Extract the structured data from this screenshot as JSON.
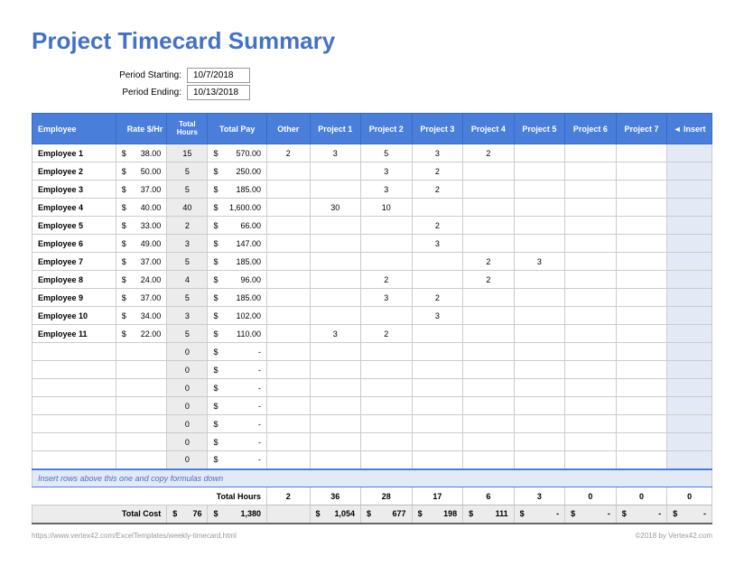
{
  "title": "Project Timecard Summary",
  "period": {
    "start_label": "Period Starting:",
    "start_value": "10/7/2018",
    "end_label": "Period Ending:",
    "end_value": "10/13/2018"
  },
  "columns": {
    "employee": "Employee",
    "rate": "Rate $/Hr",
    "total_hours_l1": "Total",
    "total_hours_l2": "Hours",
    "total_pay": "Total Pay",
    "other": "Other",
    "p1": "Project 1",
    "p2": "Project 2",
    "p3": "Project 3",
    "p4": "Project 4",
    "p5": "Project 5",
    "p6": "Project 6",
    "p7": "Project 7",
    "insert": "◄ Insert"
  },
  "rows": [
    {
      "emp": "Employee 1",
      "rate": "38.00",
      "hours": "15",
      "pay": "570.00",
      "other": "2",
      "p": [
        "3",
        "5",
        "3",
        "2",
        "",
        "",
        ""
      ]
    },
    {
      "emp": "Employee 2",
      "rate": "50.00",
      "hours": "5",
      "pay": "250.00",
      "other": "",
      "p": [
        "",
        "3",
        "2",
        "",
        "",
        "",
        ""
      ]
    },
    {
      "emp": "Employee 3",
      "rate": "37.00",
      "hours": "5",
      "pay": "185.00",
      "other": "",
      "p": [
        "",
        "3",
        "2",
        "",
        "",
        "",
        ""
      ]
    },
    {
      "emp": "Employee 4",
      "rate": "40.00",
      "hours": "40",
      "pay": "1,600.00",
      "other": "",
      "p": [
        "30",
        "10",
        "",
        "",
        "",
        "",
        ""
      ]
    },
    {
      "emp": "Employee 5",
      "rate": "33.00",
      "hours": "2",
      "pay": "66.00",
      "other": "",
      "p": [
        "",
        "",
        "2",
        "",
        "",
        "",
        ""
      ]
    },
    {
      "emp": "Employee 6",
      "rate": "49.00",
      "hours": "3",
      "pay": "147.00",
      "other": "",
      "p": [
        "",
        "",
        "3",
        "",
        "",
        "",
        ""
      ]
    },
    {
      "emp": "Employee 7",
      "rate": "37.00",
      "hours": "5",
      "pay": "185.00",
      "other": "",
      "p": [
        "",
        "",
        "",
        "2",
        "3",
        "",
        ""
      ]
    },
    {
      "emp": "Employee 8",
      "rate": "24.00",
      "hours": "4",
      "pay": "96.00",
      "other": "",
      "p": [
        "",
        "2",
        "",
        "2",
        "",
        "",
        ""
      ]
    },
    {
      "emp": "Employee 9",
      "rate": "37.00",
      "hours": "5",
      "pay": "185.00",
      "other": "",
      "p": [
        "",
        "3",
        "2",
        "",
        "",
        "",
        ""
      ]
    },
    {
      "emp": "Employee 10",
      "rate": "34.00",
      "hours": "3",
      "pay": "102.00",
      "other": "",
      "p": [
        "",
        "",
        "3",
        "",
        "",
        "",
        ""
      ]
    },
    {
      "emp": "Employee 11",
      "rate": "22.00",
      "hours": "5",
      "pay": "110.00",
      "other": "",
      "p": [
        "3",
        "2",
        "",
        "",
        "",
        "",
        ""
      ]
    }
  ],
  "empty_count": 7,
  "note": "Insert rows above this one and copy formulas down",
  "totals": {
    "hours_label": "Total Hours",
    "hours": [
      "2",
      "36",
      "28",
      "17",
      "6",
      "3",
      "0",
      "0",
      "0"
    ],
    "cost_label": "Total Cost",
    "cost_sum": "76",
    "cost_pay": "1,380",
    "costs": [
      "1,054",
      "677",
      "198",
      "111",
      "-",
      "-",
      "-"
    ]
  },
  "footer": {
    "left": "https://www.vertex42.com/ExcelTemplates/weekly-timecard.html",
    "right": "©2018 by Vertex42.com"
  }
}
